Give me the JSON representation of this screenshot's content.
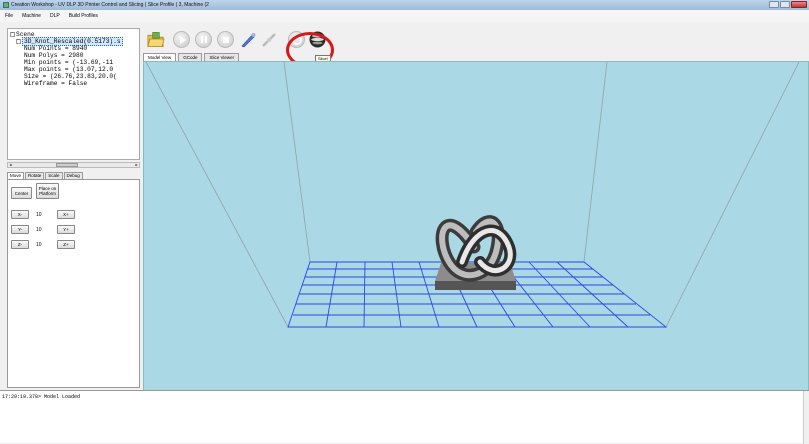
{
  "window": {
    "title": "Creation Workshop - UV DLP 3D Printer Control and Slicing ( Slice Profile ( 3, Machine (2"
  },
  "menu": [
    "File",
    "Machine",
    "DLP",
    "Build Profiles"
  ],
  "scene_tree": {
    "root": "Scene",
    "object": "3D_Knot_Rescaled(0.5173).s",
    "properties": [
      "Num Points = 8940",
      "Num Polys = 2980",
      "Min points = (-13.69,-11",
      "Max points = (13.07,12.0",
      "Size = (26.76,23.83,20.0(",
      "Wireframe = False"
    ]
  },
  "panel_tabs": [
    "Move",
    "Rotate",
    "Scale",
    "Debug"
  ],
  "move_panel": {
    "center_label": "Center",
    "place_label": "Place on Platform",
    "rows": [
      {
        "minus": "X-",
        "value": "10",
        "plus": "X+"
      },
      {
        "minus": "Y-",
        "value": "10",
        "plus": "Y+"
      },
      {
        "minus": "Z-",
        "value": "10",
        "plus": "Z+"
      }
    ]
  },
  "view_tabs": [
    "Model View",
    "GCode",
    "Slice Viewer"
  ],
  "toolbar": {
    "tooltip": "Slice!"
  },
  "log": {
    "line": "17:29:19.378> Model Loaded"
  },
  "colors": {
    "viewport": "#aad8e4",
    "grid": "#2a48e8",
    "highlight": "#d61a1a"
  }
}
